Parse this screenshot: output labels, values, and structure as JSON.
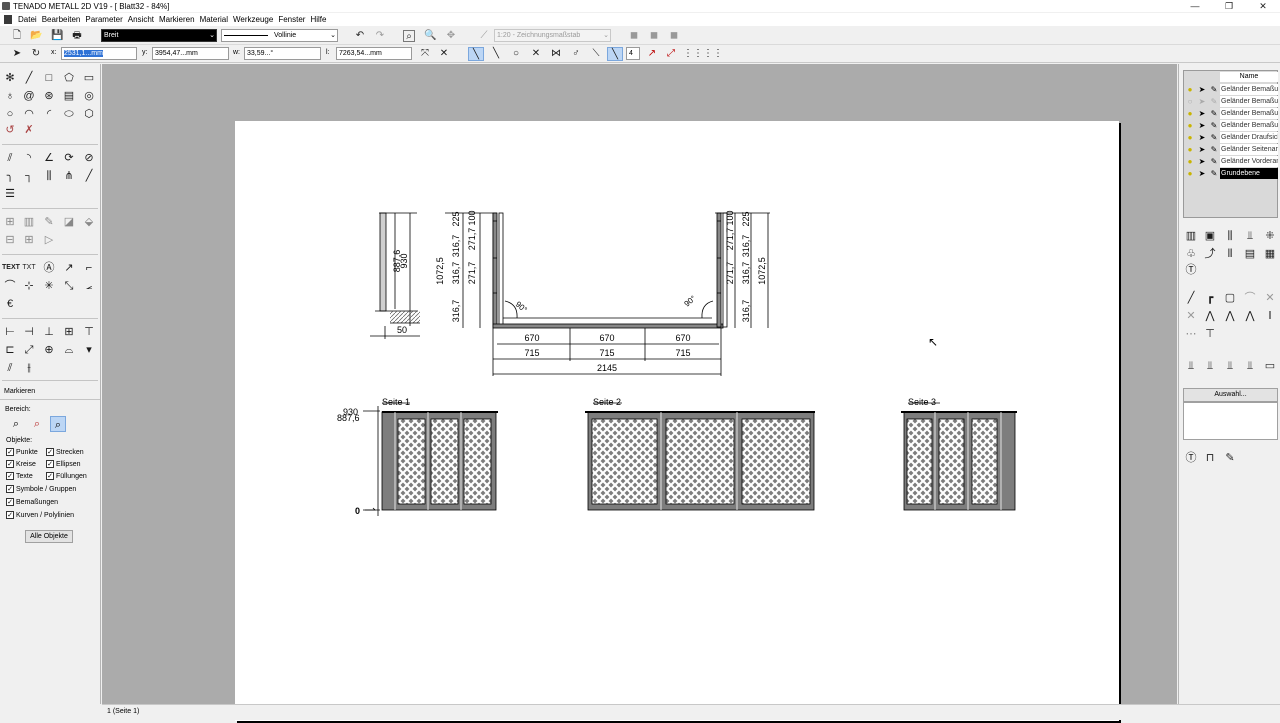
{
  "window": {
    "title": "TENADO METALL 2D V19 - [ Blatt32 - 84%]",
    "controls": [
      "—",
      "❐",
      "✕"
    ]
  },
  "menu": [
    "Datei",
    "Bearbeiten",
    "Parameter",
    "Ansicht",
    "Markieren",
    "Material",
    "Werkzeuge",
    "Fenster",
    "Hilfe"
  ],
  "toolbar": {
    "pen_width": "Breit",
    "line_type": "Vollinie",
    "scale": "1:20 - Zeichnungsmaßstab"
  },
  "coords": {
    "x_label": "x:",
    "x_value": "2531,1...mm",
    "y_label": "y:",
    "y_value": "3954,47...mm",
    "w_label": "w:",
    "w_value": "33,59...°",
    "l_label": "l:",
    "l_value": "7263,54...mm",
    "grid_value": "4"
  },
  "marking": {
    "title": "Markieren",
    "bereich": "Bereich:",
    "objekte": "Objekte:",
    "options": [
      {
        "label": "Punkte",
        "checked": true
      },
      {
        "label": "Strecken",
        "checked": true
      },
      {
        "label": "Kreise",
        "checked": true
      },
      {
        "label": "Ellipsen",
        "checked": true
      },
      {
        "label": "Texte",
        "checked": true
      },
      {
        "label": "Füllungen",
        "checked": true
      },
      {
        "label": "Symbole / Gruppen",
        "checked": true
      },
      {
        "label": "Bemaßungen",
        "checked": true
      },
      {
        "label": "Kurven / Polylinien",
        "checked": true
      }
    ],
    "all_button": "Alle Objekte"
  },
  "layers": {
    "header": "Name",
    "items": [
      "Geländer Bemaßung",
      "Geländer Bemaßung",
      "Geländer Bemaßung",
      "Geländer Bemaßung",
      "Geländer Draufsicht",
      "Geländer Seitenansicht",
      "Geländer Vorderansicht",
      "Grundebene"
    ],
    "selected": "Grundebene"
  },
  "auswahl_button": "Auswahl...",
  "status": "1 (Seite 1)",
  "drawing": {
    "side_dims": [
      "887,6",
      "930",
      "50"
    ],
    "left_dims": [
      "1072,5",
      "316,7",
      "225",
      "316,7",
      "271,7",
      "100",
      "271,7",
      "316,7"
    ],
    "right_dims": [
      "1072,5",
      "316,7",
      "225",
      "316,7",
      "271,7",
      "100",
      "271,7",
      "316,7"
    ],
    "angles": [
      "90°",
      "90°"
    ],
    "bottom_dims_row1": [
      "670",
      "670",
      "670"
    ],
    "bottom_dims_row2": [
      "715",
      "715",
      "715"
    ],
    "total": "2145",
    "elevation_labels": [
      "930",
      "887,6",
      "0"
    ],
    "sides": [
      "Seite 1",
      "Seite 2",
      "Seite 3"
    ]
  }
}
